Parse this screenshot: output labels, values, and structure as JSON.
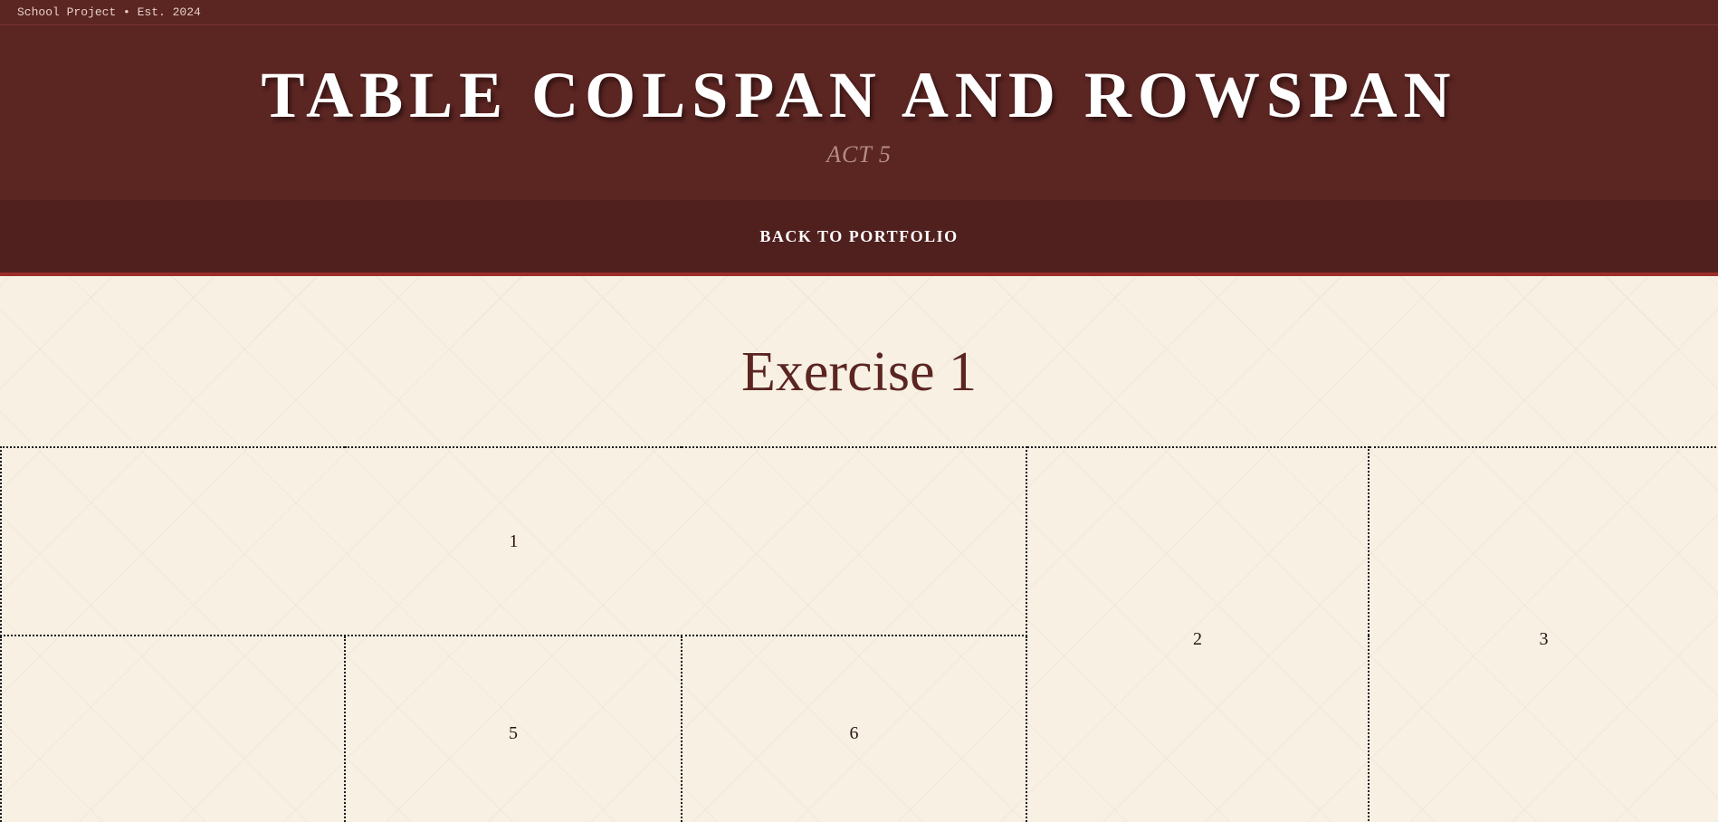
{
  "topbar": {
    "text": "School Project • Est. 2024"
  },
  "hero": {
    "title": "TABLE COLSPAN AND ROWSPAN",
    "subtitle": "ACT 5"
  },
  "nav": {
    "back_label": "BACK TO PORTFOLIO"
  },
  "exercise": {
    "title": "Exercise 1",
    "cells": {
      "c1": "1",
      "c2": "2",
      "c3": "3",
      "c4": "",
      "c5": "5",
      "c6": "6"
    }
  },
  "colors": {
    "header_bg": "#5b2522",
    "nav_bg": "#4f201d",
    "accent": "#9b2e2a",
    "page_bg": "#f7f0e3"
  }
}
